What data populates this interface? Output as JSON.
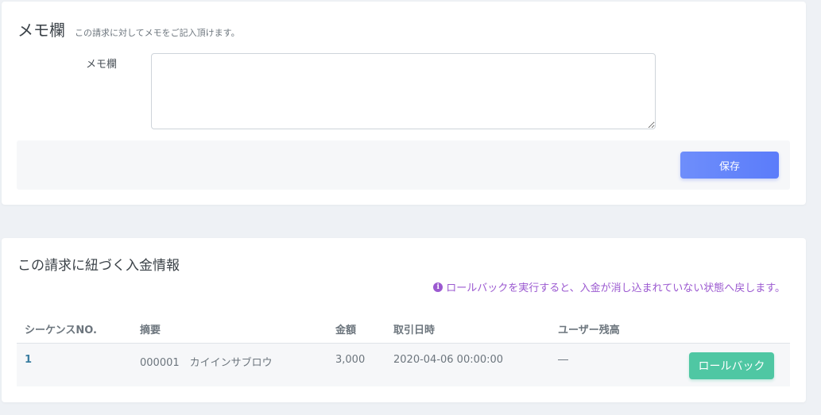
{
  "memo": {
    "title": "メモ欄",
    "subtitle": "この請求に対してメモをご記入頂けます。",
    "field_label": "メモ欄",
    "field_value": "",
    "save_label": "保存"
  },
  "payments": {
    "title": "この請求に紐づく入金情報",
    "notice": "ロールバックを実行すると、入金が消し込まれていない状態へ戻します。",
    "columns": [
      "シーケンスNO.",
      "摘要",
      "金額",
      "取引日時",
      "ユーザー残高"
    ],
    "rows": [
      {
        "sequence": "1",
        "summary": "000001　カイインサブロウ",
        "amount": "3,000",
        "datetime": "2020-04-06 00:00:00",
        "balance": "―",
        "action_label": "ロールバック"
      }
    ]
  },
  "colors": {
    "primary": "#5b7cfa",
    "success": "#4fc7a3",
    "notice": "#9b59d0"
  }
}
